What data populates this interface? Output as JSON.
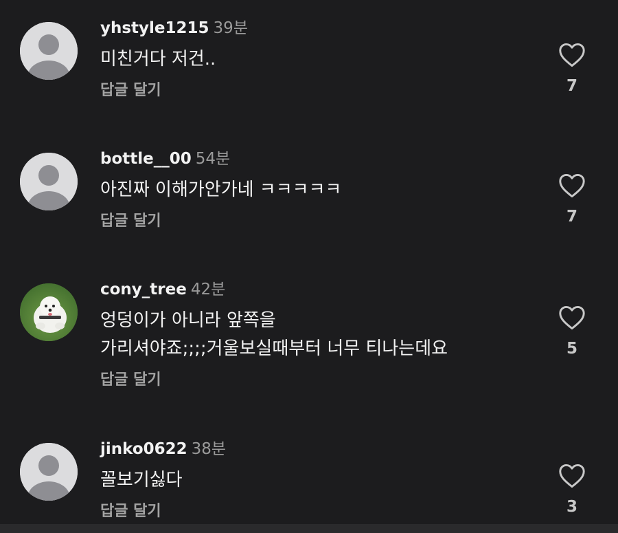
{
  "comments": [
    {
      "username": "yhstyle1215",
      "time": "39분",
      "text_lines": [
        "미친거다 저건.."
      ],
      "reply_label": "답글 달기",
      "likes": "7",
      "avatar": "default-avatar"
    },
    {
      "username": "bottle__00",
      "time": "54분",
      "text_lines": [
        "아진짜 이해가안가네 ㅋㅋㅋㅋㅋ"
      ],
      "reply_label": "답글 달기",
      "likes": "7",
      "avatar": "default-avatar"
    },
    {
      "username": "cony_tree",
      "time": "42분",
      "text_lines": [
        "엉덩이가 아니라 앞쪽을",
        "가리셔야죠;;;;거울보실때부터 너무 티나는데요"
      ],
      "reply_label": "답글 달기",
      "likes": "5",
      "avatar": "dog-photo-avatar"
    },
    {
      "username": "jinko0622",
      "time": "38분",
      "text_lines": [
        "꼴보기싫다"
      ],
      "reply_label": "답글 달기",
      "likes": "3",
      "avatar": "default-avatar"
    }
  ],
  "icons": {
    "like": "heart-outline-icon"
  },
  "colors": {
    "background": "#1c1c1e",
    "username": "#f2f2f2",
    "timestamp": "#9a9a9a",
    "reply": "#a3a3a3",
    "default_avatar_bg": "#dcdcde",
    "default_avatar_figure": "#8e8e93"
  }
}
